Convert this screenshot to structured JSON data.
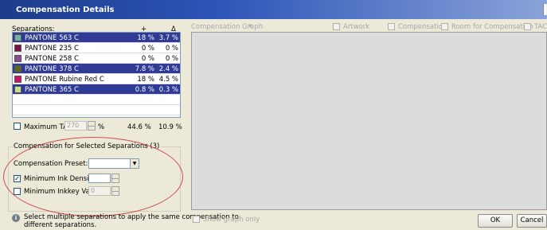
{
  "window": {
    "title": "Compensation Details"
  },
  "separations": {
    "header_label": "Separations:",
    "col_percent_symbol": "+",
    "col_delta_symbol": "Δ",
    "rows": [
      {
        "name": "PANTONE 563 C",
        "percent": "18 %",
        "delta": "3.7 %",
        "swatch": "#6fb3a6",
        "selected": true
      },
      {
        "name": "PANTONE 235 C",
        "percent": "0 %",
        "delta": "0 %",
        "swatch": "#7a1245",
        "selected": false
      },
      {
        "name": "PANTONE 258 C",
        "percent": "0 %",
        "delta": "0 %",
        "swatch": "#8b4a9a",
        "selected": false
      },
      {
        "name": "PANTONE 378 C",
        "percent": "7.8 %",
        "delta": "2.4 %",
        "swatch": "#5b6a1a",
        "selected": true
      },
      {
        "name": "PANTONE Rubine Red C",
        "percent": "18 %",
        "delta": "4.5 %",
        "swatch": "#d0106a",
        "selected": false
      },
      {
        "name": "PANTONE 365 C",
        "percent": "0.8 %",
        "delta": "0.3 %",
        "swatch": "#c6e08e",
        "selected": true
      }
    ]
  },
  "tac": {
    "label": "Maximum TAC:",
    "value": "270",
    "unit": "%",
    "total_percent": "44.6 %",
    "total_delta": "10.9 %"
  },
  "compensation_group": {
    "legend": "Compensation for Selected Separations (3)",
    "preset_label": "Compensation Preset:",
    "preset_value": "",
    "min_ink_density_label": "Minimum Ink Density:",
    "min_ink_density_value": "",
    "min_inkkey_label": "Minimum Inkkey Value:",
    "min_inkkey_value": "0"
  },
  "info": {
    "icon": "info-icon",
    "line1": "Select multiple separations to apply the same compensation to",
    "line2": "different separations."
  },
  "graph": {
    "header_label": "Compensation Graph",
    "options": [
      "Artwork",
      "Compensation",
      "Room for Compensation",
      "TAC"
    ],
    "show_graph_only_label": "Show graph only"
  },
  "buttons": {
    "ok": "OK",
    "cancel": "Cancel"
  }
}
